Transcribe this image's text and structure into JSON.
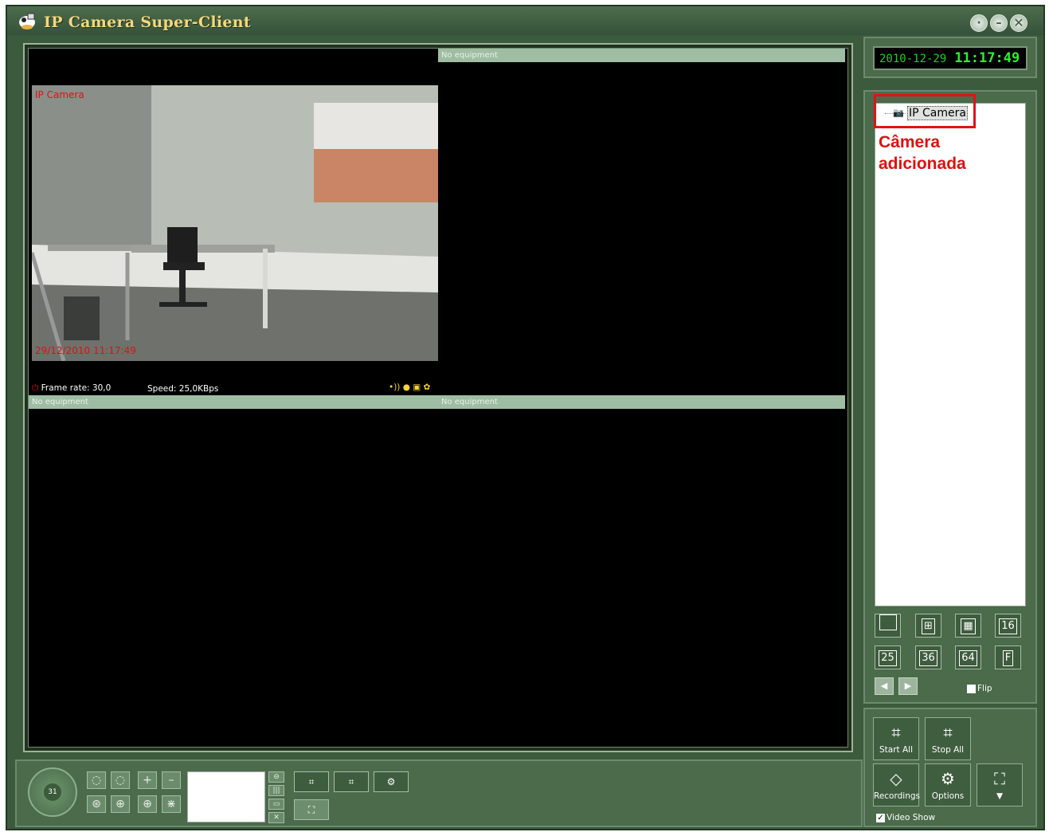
{
  "app": {
    "title": "IP Camera Super-Client"
  },
  "clock": {
    "date": "2010-12-29",
    "time": "11:17:49"
  },
  "video": {
    "cam1": {
      "label": "IP Camera",
      "timestamp": "29/12/2010 11:17:49",
      "frame_rate": "Frame rate: 30,0",
      "speed": "Speed: 25,0KBps"
    },
    "cam2": {
      "label": "No equipment"
    },
    "cam3": {
      "label": "No equipment"
    },
    "cam4": {
      "label": "No equipment"
    }
  },
  "tree": {
    "items": [
      {
        "label": "IP Camera"
      }
    ]
  },
  "annotation": {
    "line1": "Câmera",
    "line2": "adicionada"
  },
  "layouts": {
    "b1": "",
    "b2": "",
    "b3": "",
    "b4": "16",
    "b5": "25",
    "b6": "36",
    "b7": "64",
    "b8": "F"
  },
  "flip": {
    "label": "Flip"
  },
  "actions": {
    "start_all": "Start All",
    "stop_all": "Stop All",
    "recordings": "Recordings",
    "options": "Options"
  },
  "video_show": {
    "label": "Video Show"
  },
  "ptz": {
    "value": "31"
  }
}
